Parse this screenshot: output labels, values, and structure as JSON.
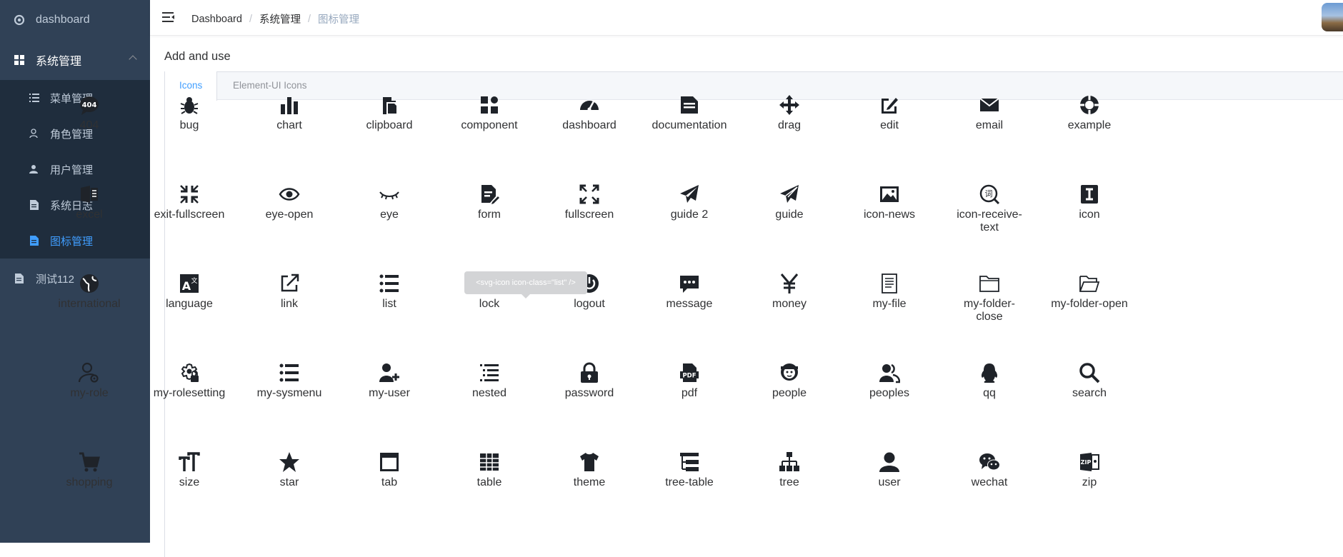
{
  "sidebar": {
    "top_items": [
      {
        "label": "dashboard",
        "icon": "dashboard-icon"
      },
      {
        "label": "系统管理",
        "icon": "component-icon"
      },
      {
        "label": "测试112",
        "icon": "documentation-icon"
      }
    ],
    "sub_items": [
      {
        "label": "菜单管理",
        "icon": "list-icon"
      },
      {
        "label": "角色管理",
        "icon": "user-icon"
      },
      {
        "label": "用户管理",
        "icon": "user-add-icon"
      },
      {
        "label": "系统日志",
        "icon": "log-icon"
      },
      {
        "label": "图标管理",
        "icon": "icon-manage-icon"
      }
    ],
    "active_item": "图标管理",
    "active_color": "#409eff",
    "bg_color": "#304156"
  },
  "navbar": {
    "breadcrumb": [
      "Dashboard",
      "系统管理",
      "图标管理"
    ]
  },
  "main": {
    "section_title": "Add and use",
    "tabs": [
      "Icons",
      "Element-UI Icons"
    ],
    "active_tab": "Icons",
    "tooltip": "<svg-icon icon-class=\"list\" />",
    "icons": [
      "404",
      "bug",
      "chart",
      "clipboard",
      "component",
      "dashboard",
      "documentation",
      "drag",
      "edit",
      "email",
      "example",
      "excel",
      "exit-fullscreen",
      "eye-open",
      "eye",
      "form",
      "fullscreen",
      "guide 2",
      "guide",
      "icon-news",
      "icon-receive-text",
      "icon",
      "international",
      "language",
      "link",
      "list",
      "lock",
      "logout",
      "message",
      "money",
      "my-file",
      "my-folder-close",
      "my-folder-open",
      "my-role",
      "my-rolesetting",
      "my-sysmenu",
      "my-user",
      "nested",
      "password",
      "pdf",
      "people",
      "peoples",
      "qq",
      "search",
      "shopping",
      "size",
      "star",
      "tab",
      "table",
      "theme",
      "tree-table",
      "tree",
      "user",
      "wechat",
      "zip"
    ]
  }
}
